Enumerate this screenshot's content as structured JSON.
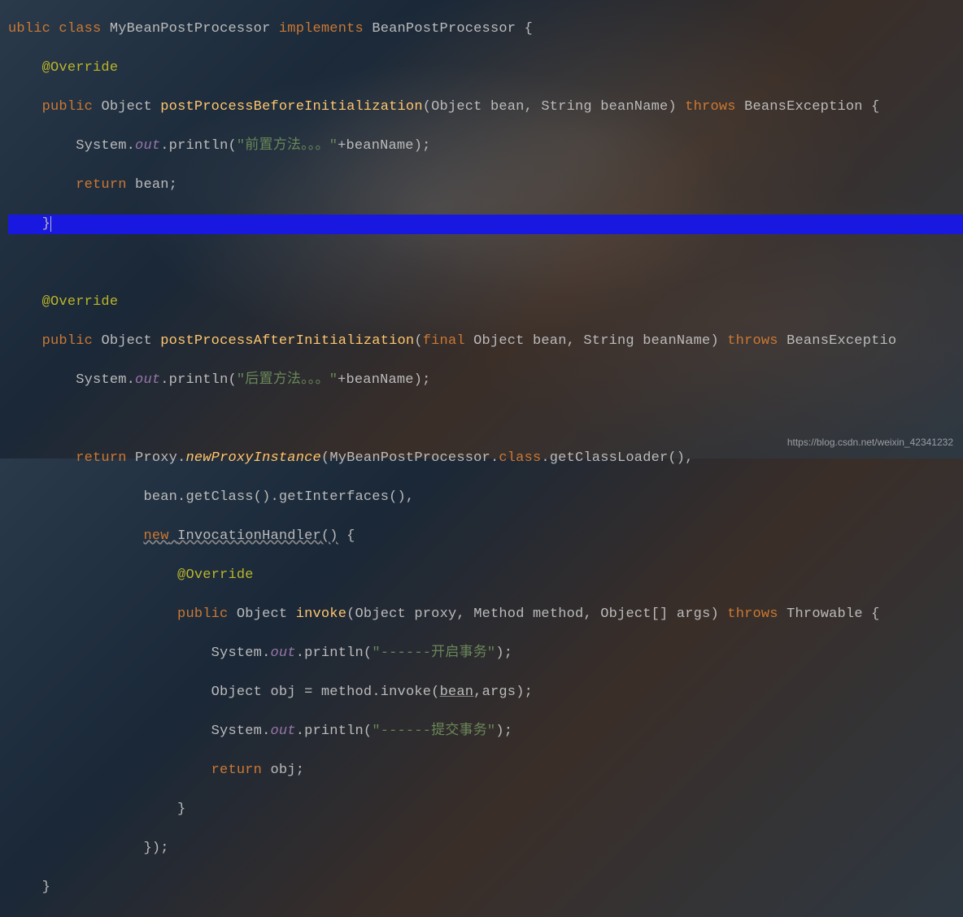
{
  "code": {
    "l1": {
      "kw1": "ublic",
      "kw2": "class",
      "cls": "MyBeanPostProcessor",
      "kw3": "implements",
      "iface": "BeanPostProcessor",
      "brace": "{"
    },
    "l2": {
      "ann": "@Override"
    },
    "l3": {
      "kw1": "public",
      "ret": "Object",
      "method": "postProcessBeforeInitialization",
      "p1t": "Object",
      "p1n": "bean",
      "p2t": "String",
      "p2n": "beanName",
      "kw2": "throws",
      "exc": "BeansException",
      "brace": "{"
    },
    "l4": {
      "cls": "System",
      "field": "out",
      "method": "println",
      "str": "\"前置方法。。。\"",
      "op": "+",
      "var": "beanName"
    },
    "l5": {
      "kw": "return",
      "var": "bean"
    },
    "l6": {
      "brace": "}"
    },
    "l7": "",
    "l8": {
      "ann": "@Override"
    },
    "l9": {
      "kw1": "public",
      "ret": "Object",
      "method": "postProcessAfterInitialization",
      "kw2": "final",
      "p1t": "Object",
      "p1n": "bean",
      "p2t": "String",
      "p2n": "beanName",
      "kw3": "throws",
      "exc": "BeansExceptio"
    },
    "l10": {
      "cls": "System",
      "field": "out",
      "method": "println",
      "str": "\"后置方法。。。\"",
      "op": "+",
      "var": "beanName"
    },
    "l11": "",
    "l12": {
      "kw": "return",
      "cls": "Proxy",
      "method": "newProxyInstance",
      "arg1a": "MyBeanPostProcessor",
      "arg1b": "class",
      "arg1c": "getClassLoader"
    },
    "l13": {
      "var": "bean",
      "m1": "getClass",
      "m2": "getInterfaces"
    },
    "l14": {
      "kw": "new",
      "cls": "InvocationHandler",
      "brace": "{"
    },
    "l15": {
      "ann": "@Override"
    },
    "l16": {
      "kw1": "public",
      "ret": "Object",
      "method": "invoke",
      "p1t": "Object",
      "p1n": "proxy",
      "p2t": "Method",
      "p2n": "method",
      "p3t": "Object[]",
      "p3n": "args",
      "kw2": "throws",
      "exc": "Throwable",
      "brace": "{"
    },
    "l17": {
      "cls": "System",
      "field": "out",
      "method": "println",
      "str": "\"------开启事务\""
    },
    "l18": {
      "type": "Object",
      "var": "obj",
      "eq": "=",
      "obj": "method",
      "m": "invoke",
      "a1": "bean",
      "a2": "args"
    },
    "l19": {
      "cls": "System",
      "field": "out",
      "method": "println",
      "str": "\"------提交事务\""
    },
    "l20": {
      "kw": "return",
      "var": "obj"
    },
    "l21": {
      "brace": "}"
    },
    "l22": {
      "brace": "});"
    },
    "l23": {
      "brace": "}"
    }
  },
  "watermark": "https://blog.csdn.net/weixin_42341232"
}
